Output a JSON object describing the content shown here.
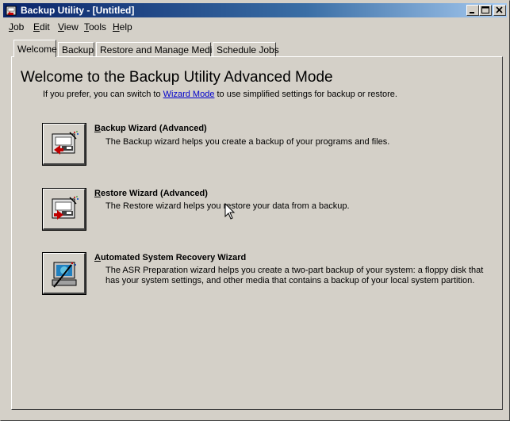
{
  "window": {
    "title": "Backup Utility - [Untitled]"
  },
  "titlebar_buttons": {
    "minimize": "minimize-icon",
    "maximize": "maximize-icon",
    "close": "close-icon"
  },
  "menu": {
    "items": [
      {
        "label": "Job",
        "accel": "J",
        "rest": "ob"
      },
      {
        "label": "Edit",
        "accel": "E",
        "rest": "dit"
      },
      {
        "label": "View",
        "accel": "V",
        "rest": "iew"
      },
      {
        "label": "Tools",
        "accel": "T",
        "rest": "ools"
      },
      {
        "label": "Help",
        "accel": "H",
        "rest": "elp"
      }
    ]
  },
  "tabs": [
    {
      "label": "Welcome",
      "active": true
    },
    {
      "label": "Backup",
      "active": false
    },
    {
      "label": "Restore and Manage Media",
      "active": false
    },
    {
      "label": "Schedule Jobs",
      "active": false
    }
  ],
  "welcome": {
    "heading": "Welcome to the Backup Utility Advanced Mode",
    "intro_before": "If you prefer, you can switch to ",
    "intro_link": "Wizard Mode",
    "intro_after": " to use simplified settings for backup or restore.",
    "wizards": [
      {
        "title_accel": "B",
        "title_rest": "ackup Wizard (Advanced)",
        "description": "The Backup wizard helps you create a backup of your programs and files.",
        "icon": "backup-wizard-icon"
      },
      {
        "title_accel": "R",
        "title_rest": "estore Wizard (Advanced)",
        "description": "The Restore wizard helps you restore your data from a backup.",
        "icon": "restore-wizard-icon"
      },
      {
        "title_accel": "A",
        "title_rest": "utomated System Recovery Wizard",
        "description": "The ASR Preparation wizard helps you create a two-part backup of your system: a floppy disk that has your system settings, and other media that contains a backup of your local system partition.",
        "icon": "asr-wizard-icon"
      }
    ]
  },
  "colors": {
    "face": "#d4d0c8",
    "title_start": "#0a246a",
    "title_end": "#a6caf0",
    "link": "#0000cc"
  }
}
